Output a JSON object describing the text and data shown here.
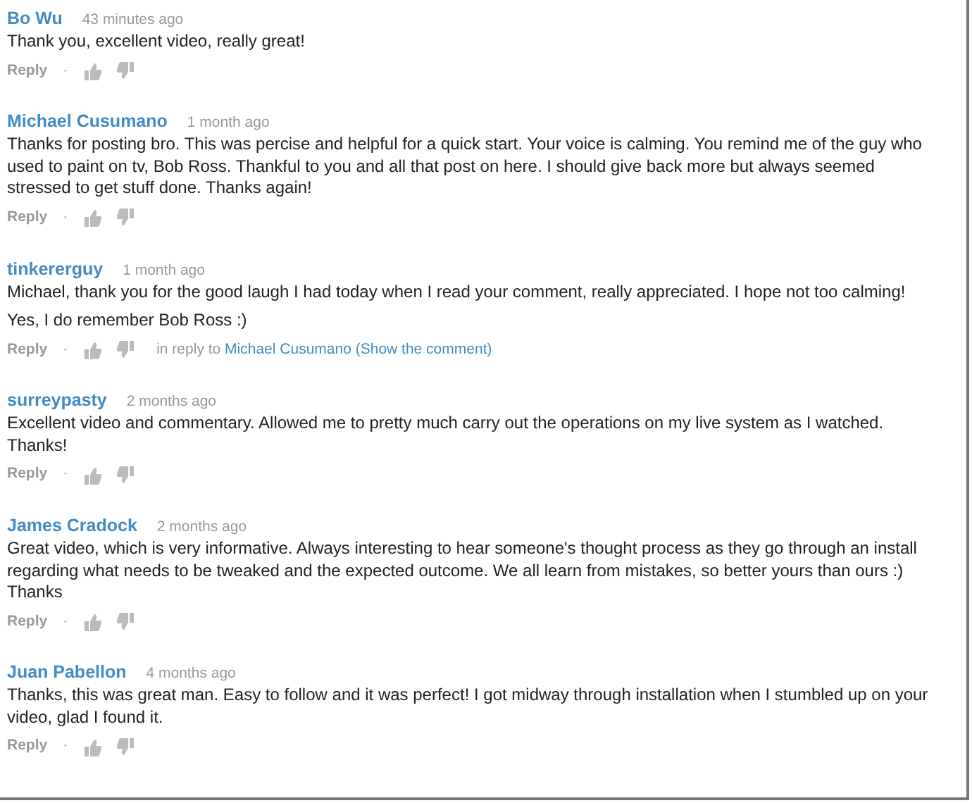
{
  "comments": [
    {
      "author": "Bo Wu",
      "time": "43 minutes ago",
      "paragraphs": [
        "Thank you, excellent video, really great!"
      ],
      "reply": "Reply",
      "separator": "·"
    },
    {
      "author": "Michael Cusumano",
      "time": "1 month ago",
      "paragraphs": [
        "Thanks for posting bro. This was percise and helpful for a quick start. Your voice is calming. You remind me of the guy who used to paint on tv, Bob Ross. Thankful to you and all that post on here. I should give back more but always seemed stressed to get stuff done. Thanks again!"
      ],
      "reply": "Reply",
      "separator": "·"
    },
    {
      "author": "tinkererguy",
      "time": "1 month ago",
      "paragraphs": [
        "Michael, thank you for the good laugh I had today when I read your comment, really appreciated. I hope not too calming!",
        "Yes, I do remember Bob Ross :)"
      ],
      "reply": "Reply",
      "separator": "·",
      "in_reply": {
        "prefix": "in reply to",
        "author": "Michael Cusumano",
        "link": "(Show the comment)"
      }
    },
    {
      "author": "surreypasty",
      "time": "2 months ago",
      "paragraphs": [
        "Excellent video and commentary. Allowed me to pretty much carry out the operations on my live system as I watched. Thanks!"
      ],
      "reply": "Reply",
      "separator": "·"
    },
    {
      "author": "James Cradock",
      "time": "2 months ago",
      "paragraphs": [
        "Great video, which is very informative. Always interesting to hear someone's thought process as they go through an install regarding what needs to be tweaked and the expected outcome. We all learn from mistakes, so better yours than ours :) Thanks"
      ],
      "reply": "Reply",
      "separator": "·"
    },
    {
      "author": "Juan Pabellon",
      "time": "4 months ago",
      "paragraphs": [
        "Thanks, this was great man. Easy to follow and it was perfect! I got midway through installation when I stumbled up on your video, glad I found it."
      ],
      "reply": "Reply",
      "separator": "·"
    }
  ]
}
